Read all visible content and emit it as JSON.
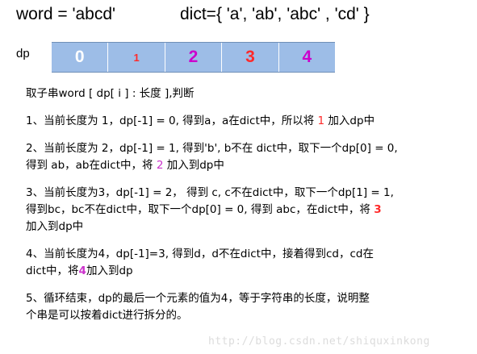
{
  "header": {
    "word": "word = 'abcd'",
    "dict": "dict={ 'a', 'ab', 'abc' , 'cd' }"
  },
  "dp_label": "dp",
  "dp_cells": [
    {
      "value": "0",
      "color": "#ffffff",
      "size": "large"
    },
    {
      "value": "1",
      "color": "#ff2a2a",
      "size": "small"
    },
    {
      "value": "2",
      "color": "#cc00cc",
      "size": "large"
    },
    {
      "value": "3",
      "color": "#ff2a2a",
      "size": "large"
    },
    {
      "value": "4",
      "color": "#cc00cc",
      "size": "large"
    }
  ],
  "colors": {
    "cell_background": "#9dbde7",
    "highlight_red": "#ff2a2a",
    "highlight_magenta": "#cc33cc"
  },
  "explanation": {
    "intro": "取子串word [ dp[ i ] : 长度 ],判断",
    "step1": {
      "a": "1、当前长度为 1，dp[-1] = 0, 得到a，a在dict中，所以将 ",
      "num": "1",
      "b": " 加入dp中"
    },
    "step2": {
      "line1": "2、当前长度为 2，dp[-1] = 1, 得到'b', b不在 dict中，取下一个dp[0] = 0,",
      "a": "得到  ab，ab在dict中，将 ",
      "num": "2",
      "b": " 加入到dp中"
    },
    "step3": {
      "line1": "3、当前长度为3，dp[-1] = 2，  得到 c, c不在dict中，取下一个dp[1] = 1,",
      "a": "得到bc，bc不在dict中，取下一个dp[0] = 0, 得到 abc，在dict中，将 ",
      "num": "3",
      "line3": "加入到dp中"
    },
    "step4": {
      "line1": "4、当前长度为4，dp[-1]=3, 得到d，d不在dict中，接着得到cd，cd在",
      "a": "dict中，将",
      "num": "4",
      "b": "加入到dp"
    },
    "step5": {
      "line1": "5、循环结束，dp的最后一个元素的值为4，等于字符串的长度，说明整",
      "line2": "个串是可以按着dict进行拆分的。"
    }
  },
  "watermark": "http://blog.csdn.net/shiquxinkong"
}
